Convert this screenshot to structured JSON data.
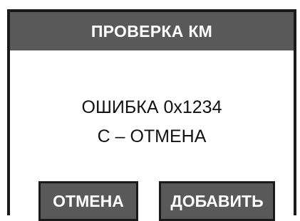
{
  "header": {
    "title": "ПРОВЕРКА КМ"
  },
  "message": {
    "line1": "ОШИБКА 0x1234",
    "line2": "С – ОТМЕНА"
  },
  "buttons": {
    "cancel_label": "ОТМЕНА",
    "add_label": "ДОБАВИТЬ"
  },
  "colors": {
    "header_bg": "#595959",
    "button_bg": "#595959",
    "border": "#1a1a1a",
    "text_on_dark": "#ffffff",
    "text": "#111111"
  }
}
